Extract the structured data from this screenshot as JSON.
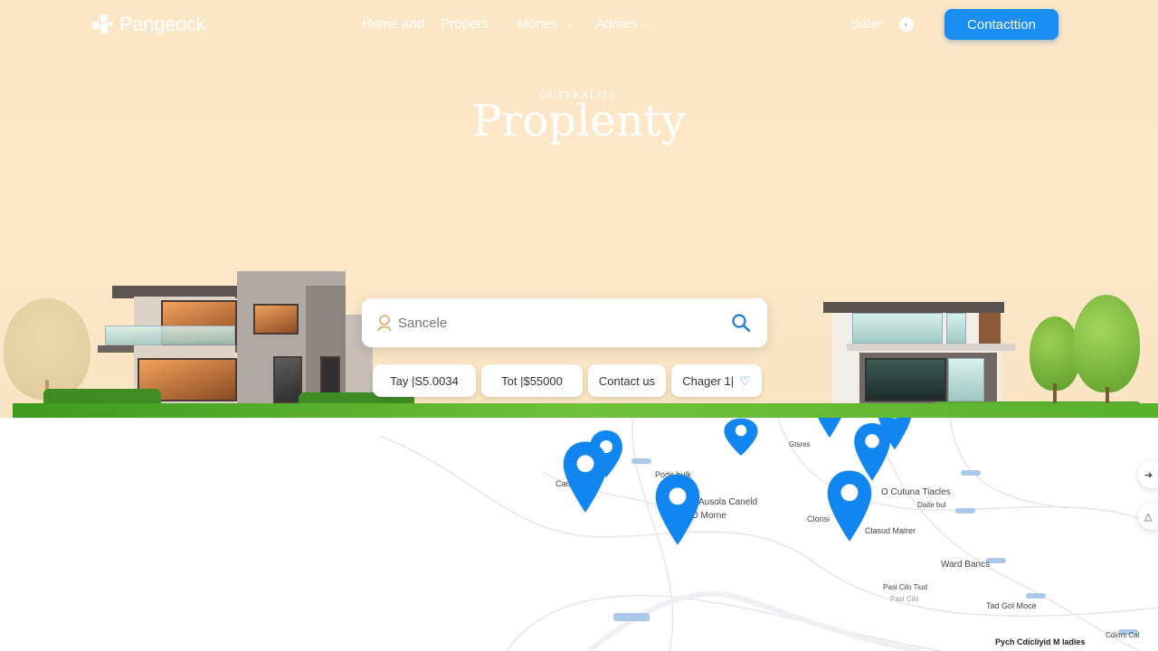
{
  "brand": {
    "name": "Pangeock"
  },
  "nav": {
    "links": [
      {
        "label": "Home and",
        "has_menu": false
      },
      {
        "label": "Propers",
        "has_menu": true
      },
      {
        "label": "Mones",
        "has_menu": true
      },
      {
        "label": "Admes",
        "has_menu": true
      }
    ],
    "saler_label": "Sater",
    "cta_label": "Contacttion"
  },
  "hero": {
    "overline": "OUTERALITY",
    "title": "Proplenty"
  },
  "search": {
    "placeholder": "Sancele"
  },
  "filters": [
    {
      "label": "Tay |S5.0034"
    },
    {
      "label": "Tot |$55000"
    },
    {
      "label": "Contact us"
    },
    {
      "label": "Chager 1|",
      "icon": "heart-icon"
    }
  ],
  "map": {
    "labels": [
      "Cadsto",
      "Pode bulk",
      "Ausola Caneld",
      "O Morne",
      "Gtsres",
      "O Cutuna Tiacles",
      "Daite bul",
      "Clonsi",
      "Clasud Malrer",
      "Ward Bancs",
      "Pasl Cilo Tiud",
      "Tad Gol Moce",
      "Pasl Cilo",
      "Pych Cdicliyid M ladies",
      "Cdiors Cal"
    ]
  },
  "colors": {
    "accent": "#1a8df0",
    "marker": "#1286f0",
    "hero_bg": "#fce8c9"
  }
}
